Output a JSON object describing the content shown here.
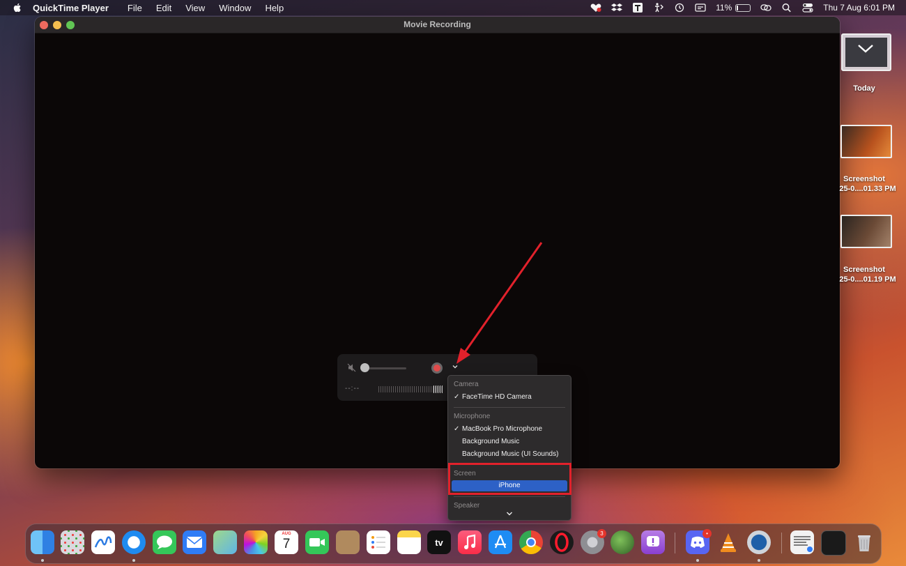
{
  "menubar": {
    "app_name": "QuickTime Player",
    "menus": [
      "File",
      "Edit",
      "View",
      "Window",
      "Help"
    ],
    "battery_percent": "11%",
    "datetime": "Thu 7 Aug  6:01 PM"
  },
  "window": {
    "title": "Movie Recording"
  },
  "controls": {
    "time": "--:--",
    "volume_level": 0
  },
  "dropdown": {
    "camera_header": "Camera",
    "camera_item": "FaceTime HD Camera",
    "check": "✓",
    "microphone_header": "Microphone",
    "mic_items": [
      "MacBook Pro Microphone",
      "Background Music",
      "Background Music (UI Sounds)"
    ],
    "screen_header": "Screen",
    "screen_item": "iPhone",
    "speaker_header": "Speaker"
  },
  "desktop": {
    "stack_label": "Today",
    "screenshots": [
      {
        "line1": "Screenshot",
        "line2": "25-0....01.33 PM"
      },
      {
        "line1": "Screenshot",
        "line2": "25-0....01.19 PM"
      }
    ]
  },
  "dock": {
    "calendar_month": "AUG",
    "calendar_day": "7",
    "tv_label": "tv",
    "settings_badge": "3",
    "discord_badge": "•",
    "colors": {
      "finder": "#3a8ee6",
      "launchpad": "#d9d9de",
      "freeform": "#ffffff",
      "safari": "#1f8bf0",
      "messages": "#35c759",
      "mail": "#2f7cf6",
      "maps": "#6fbf5a",
      "photos": "#ffffff",
      "calendar": "#ffffff",
      "facetime": "#34c759",
      "contacts": "#b08a5e",
      "reminders": "#ffffff",
      "notes": "#fbd54a",
      "appletv": "#111111",
      "music": "#fa2d48",
      "appstore": "#1e8cf4",
      "chrome": "#ffffff",
      "opera": "#1a1a1a",
      "settings": "#8e8e93",
      "globe": "#3f7a2f",
      "feedback": "#a25ad9",
      "discord": "#5865f2",
      "vlc": "#f08c1e",
      "quicktime": "#cfd4da",
      "preview": "#f2f2f2",
      "window": "#1a1a1a",
      "trash": "#c9c9cc"
    }
  }
}
